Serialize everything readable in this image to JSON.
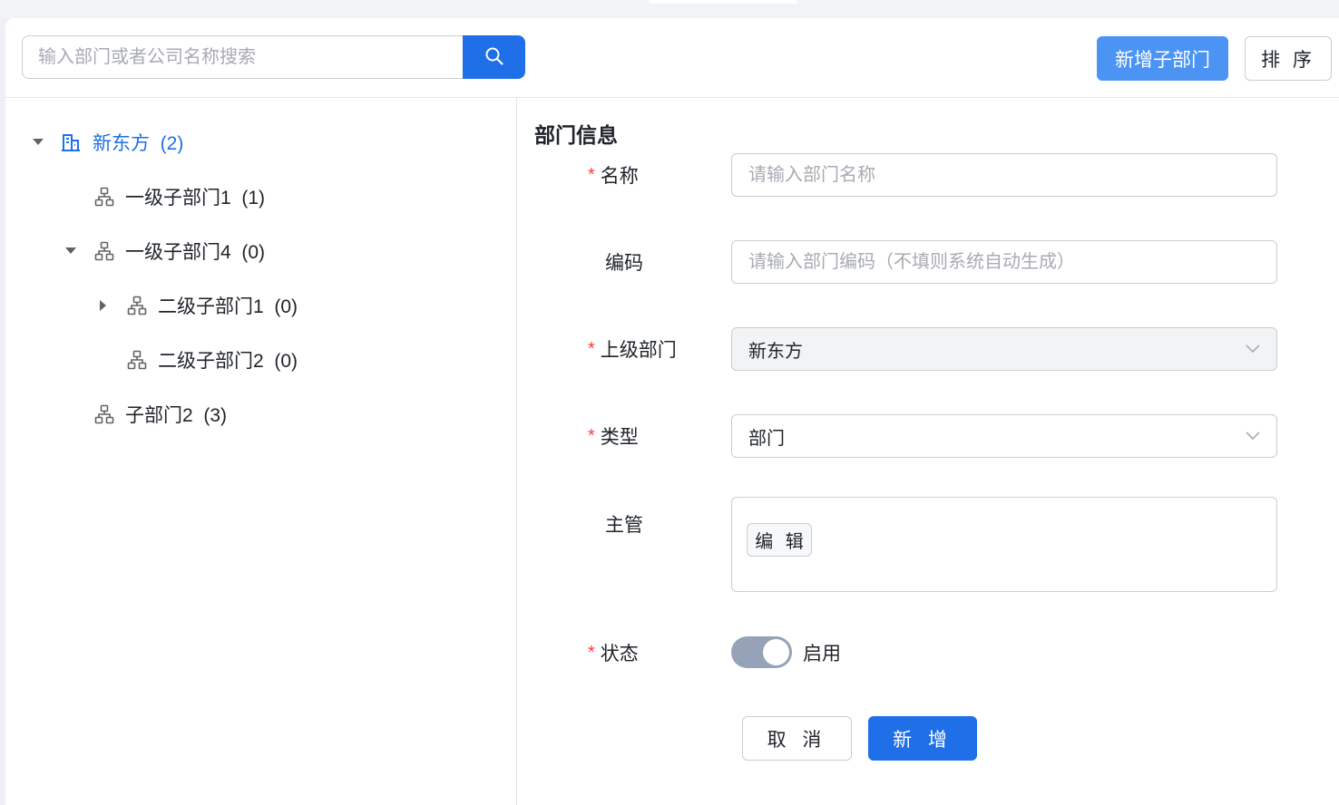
{
  "search": {
    "placeholder": "输入部门或者公司名称搜索",
    "button_icon": "search-icon"
  },
  "toolbar": {
    "add_sub_label": "新增子部门",
    "sort_label": "排 序"
  },
  "colors": {
    "primary": "#1e6fe8",
    "primary_light": "#4b94f4",
    "required": "#f53f3f",
    "toggle_on": "#96a3b6"
  },
  "tree": {
    "root": {
      "label": "新东方  (2)",
      "icon": "building-icon",
      "expanded": true
    },
    "items": [
      {
        "label": "一级子部门1  (1)",
        "icon": "org-chart-icon",
        "level": 1,
        "arrow": "none"
      },
      {
        "label": "一级子部门4  (0)",
        "icon": "org-chart-icon",
        "level": 1,
        "arrow": "expanded"
      },
      {
        "label": "二级子部门1  (0)",
        "icon": "org-chart-icon",
        "level": 2,
        "arrow": "collapsed"
      },
      {
        "label": "二级子部门2  (0)",
        "icon": "org-chart-icon",
        "level": 2,
        "arrow": "none"
      },
      {
        "label": "子部门2  (3)",
        "icon": "org-chart-icon",
        "level": 1,
        "arrow": "none"
      }
    ]
  },
  "form": {
    "title": "部门信息",
    "name": {
      "label": "名称",
      "required": true,
      "placeholder": "请输入部门名称",
      "value": ""
    },
    "code": {
      "label": "编码",
      "required": false,
      "placeholder": "请输入部门编码（不填则系统自动生成）",
      "value": ""
    },
    "parent": {
      "label": "上级部门",
      "required": true,
      "value": "新东方"
    },
    "type": {
      "label": "类型",
      "required": true,
      "value": "部门"
    },
    "manager": {
      "label": "主管",
      "required": false,
      "edit_label": "编 辑"
    },
    "status": {
      "label": "状态",
      "required": true,
      "enabled": true,
      "toggle_text": "启用"
    },
    "cancel_label": "取 消",
    "submit_label": "新 增"
  }
}
